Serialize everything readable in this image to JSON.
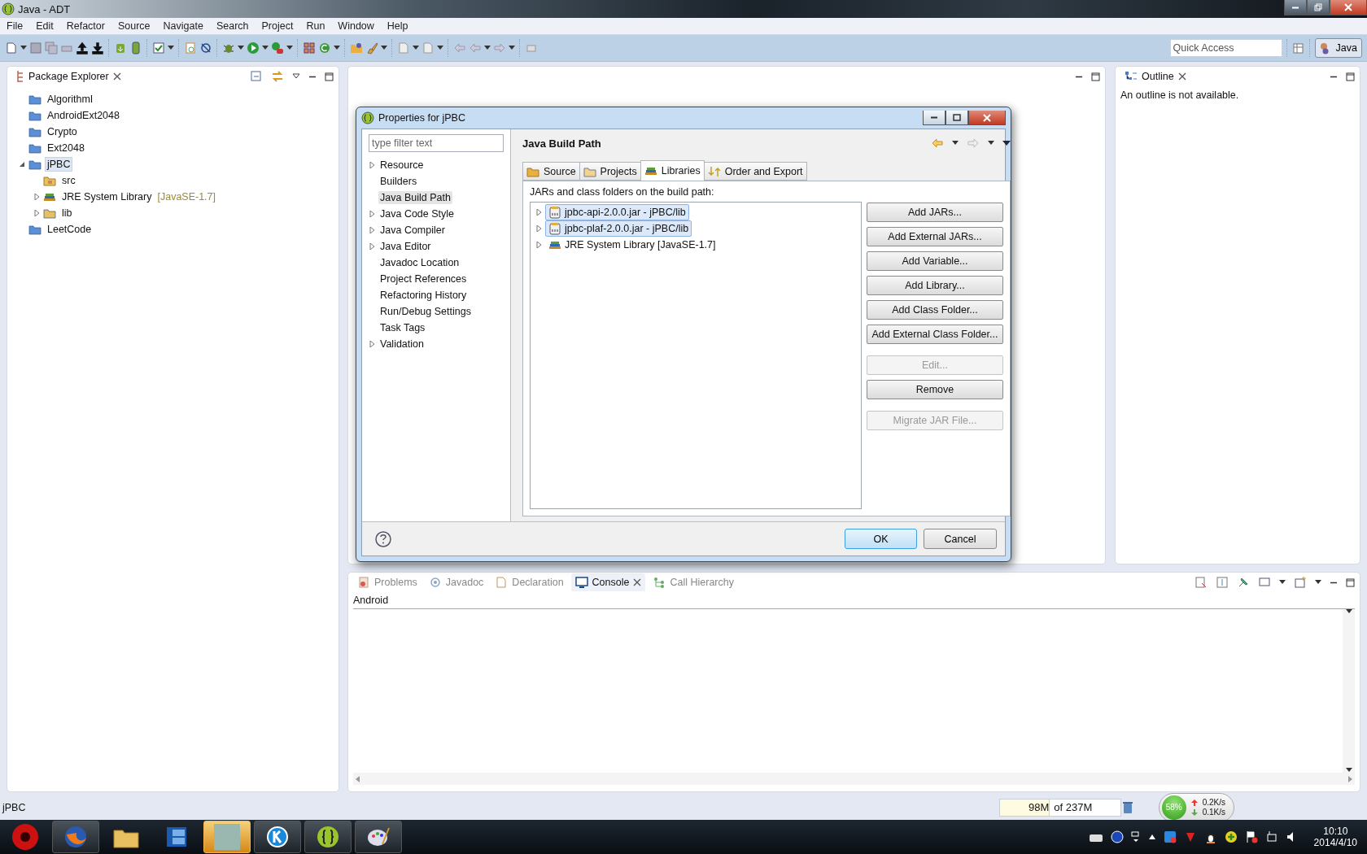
{
  "window": {
    "title": "Java - ADT"
  },
  "menu": [
    "File",
    "Edit",
    "Refactor",
    "Source",
    "Navigate",
    "Search",
    "Project",
    "Run",
    "Window",
    "Help"
  ],
  "toolbar": {
    "quick_access": {
      "placeholder": "Quick Access"
    },
    "perspective": {
      "label": "Java",
      "selected": true
    }
  },
  "package_explorer": {
    "title": "Package Explorer",
    "items": [
      {
        "label": "AlgorithmI",
        "kind": "project",
        "expandable": false,
        "selected": false
      },
      {
        "label": "AndroidExt2048",
        "kind": "project",
        "expandable": false,
        "selected": false
      },
      {
        "label": "Crypto",
        "kind": "project",
        "expandable": false,
        "selected": false
      },
      {
        "label": "Ext2048",
        "kind": "project",
        "expandable": false,
        "selected": false
      },
      {
        "label": "jPBC",
        "kind": "project",
        "expandable": true,
        "expanded": true,
        "selected": true,
        "children": [
          {
            "label": "src",
            "kind": "source-folder",
            "expandable": false,
            "selected": false
          },
          {
            "label": "JRE System Library",
            "decoration": "[JavaSE-1.7]",
            "kind": "library",
            "expandable": true,
            "expanded": false,
            "selected": false
          },
          {
            "label": "lib",
            "kind": "folder",
            "expandable": true,
            "expanded": false,
            "selected": false
          }
        ]
      },
      {
        "label": "LeetCode",
        "kind": "project",
        "expandable": false,
        "selected": false
      }
    ]
  },
  "outline": {
    "title": "Outline",
    "message": "An outline is not available."
  },
  "dialog": {
    "title": "Properties for jPBC",
    "filter": {
      "placeholder": "type filter text"
    },
    "nav": [
      {
        "label": "Resource",
        "expandable": true,
        "selected": false
      },
      {
        "label": "Builders",
        "expandable": false,
        "selected": false
      },
      {
        "label": "Java Build Path",
        "expandable": false,
        "selected": true
      },
      {
        "label": "Java Code Style",
        "expandable": true,
        "selected": false
      },
      {
        "label": "Java Compiler",
        "expandable": true,
        "selected": false
      },
      {
        "label": "Java Editor",
        "expandable": true,
        "selected": false
      },
      {
        "label": "Javadoc Location",
        "expandable": false,
        "selected": false
      },
      {
        "label": "Project References",
        "expandable": false,
        "selected": false
      },
      {
        "label": "Refactoring History",
        "expandable": false,
        "selected": false
      },
      {
        "label": "Run/Debug Settings",
        "expandable": false,
        "selected": false
      },
      {
        "label": "Task Tags",
        "expandable": false,
        "selected": false
      },
      {
        "label": "Validation",
        "expandable": true,
        "selected": false
      }
    ],
    "page_title": "Java Build Path",
    "tabs": [
      {
        "label": "Source",
        "kind": "source",
        "selected": false
      },
      {
        "label": "Projects",
        "kind": "projects",
        "selected": false
      },
      {
        "label": "Libraries",
        "kind": "libraries",
        "selected": true
      },
      {
        "label": "Order and Export",
        "kind": "order",
        "selected": false
      }
    ],
    "list_label": "JARs and class folders on the build path:",
    "entries": [
      {
        "label": "jpbc-api-2.0.0.jar - jPBC/lib",
        "kind": "jar",
        "selected": true
      },
      {
        "label": "jpbc-plaf-2.0.0.jar - jPBC/lib",
        "kind": "jar",
        "selected": true
      },
      {
        "label": "JRE System Library [JavaSE-1.7]",
        "kind": "library",
        "selected": false
      }
    ],
    "buttons": [
      {
        "label": "Add JARs...",
        "disabled": false
      },
      {
        "label": "Add External JARs...",
        "disabled": false
      },
      {
        "label": "Add Variable...",
        "disabled": false
      },
      {
        "label": "Add Library...",
        "disabled": false
      },
      {
        "label": "Add Class Folder...",
        "disabled": false
      },
      {
        "label": "Add External Class Folder...",
        "disabled": false
      },
      {
        "label": "Edit...",
        "disabled": true
      },
      {
        "label": "Remove",
        "disabled": false
      },
      {
        "label": "Migrate JAR File...",
        "disabled": true
      }
    ],
    "footer_buttons": [
      {
        "label": "OK",
        "default": true
      },
      {
        "label": "Cancel",
        "default": false
      }
    ]
  },
  "bottom_panel": {
    "tabs": [
      {
        "label": "Problems",
        "kind": "problems",
        "selected": false
      },
      {
        "label": "Javadoc",
        "kind": "javadoc",
        "selected": false
      },
      {
        "label": "Declaration",
        "kind": "declaration",
        "selected": false
      },
      {
        "label": "Console",
        "kind": "console",
        "selected": true
      },
      {
        "label": "Call Hierarchy",
        "kind": "hierarchy",
        "selected": false
      }
    ],
    "console_title": "Android"
  },
  "status_bar": {
    "selection": "jPBC",
    "memory_used": "98M",
    "memory_total": "of 237M",
    "level": 0.41
  },
  "net_widget": {
    "percent": "58%",
    "upload": "0.2K/s",
    "download": "0.1K/s"
  },
  "taskbar": {
    "time": "10:10",
    "date": "2014/4/10"
  }
}
